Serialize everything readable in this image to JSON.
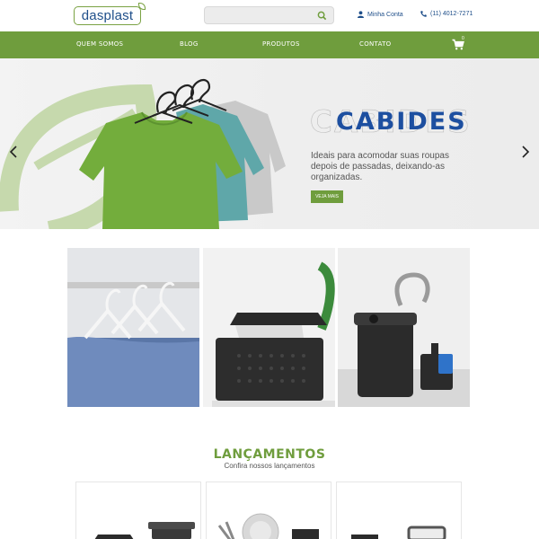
{
  "header": {
    "logo_text": "dasplast",
    "search_placeholder": "",
    "account_label": "Minha Conta",
    "phone": "(11) 4012-7271"
  },
  "nav": {
    "items": [
      "QUEM SOMOS",
      "BLOG",
      "PRODUTOS",
      "CONTATO"
    ],
    "cart_count": "0"
  },
  "hero": {
    "title": "CABIDES",
    "description": "Ideais para acomodar suas roupas depois de passadas, deixando-as organizadas.",
    "button": "VEJA MAIS"
  },
  "launches": {
    "title": "LANÇAMENTOS",
    "subtitle": "Confira nossos lançamentos"
  },
  "colors": {
    "brand_green": "#6f9d3d",
    "brand_blue": "#1d4fa0"
  }
}
